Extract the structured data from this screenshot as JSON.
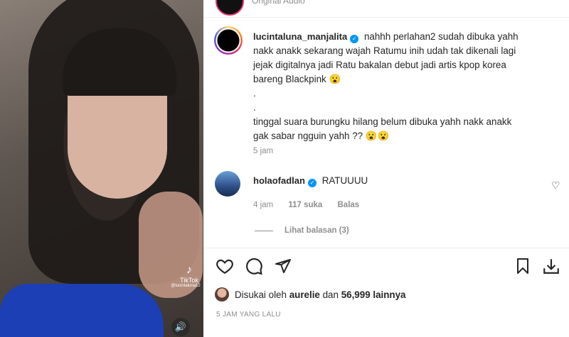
{
  "post": {
    "audio_label": "Original Audio",
    "video_watermark": {
      "app": "TikTok",
      "user": "@lucintaluna12"
    }
  },
  "comments": [
    {
      "username": "lucintaluna_manjalita",
      "lines": [
        "nahhh perlahan2 sudah dibuka yahh",
        "nakk anakk sekarang wajah Ratumu inih udah tak dikenali lagi",
        "jejak digitalnya jadi Ratu bakalan debut jadi artis kpop korea",
        "bareng Blackpink 😮",
        ".",
        ".",
        "tinggal suara burungku hilang belum dibuka yahh nakk anakk",
        "gak sabar ngguin yahh ?? 😮😮"
      ],
      "time": "5 jam"
    },
    {
      "username": "holaofadlan",
      "text": "RATUUUU",
      "time": "4 jam",
      "likes": "117 suka",
      "reply": "Balas",
      "view_replies": "Lihat balasan (3)"
    }
  ],
  "likes": {
    "prefix": "Disukai oleh",
    "user": "aurelie",
    "joiner": "dan",
    "others": "56,999 lainnya"
  },
  "time_ago": "5 JAM YANG LALU",
  "icons": [
    "heart-icon",
    "comment-icon",
    "share-icon",
    "bookmark-icon",
    "download-icon",
    "verified-icon",
    "sound-icon"
  ]
}
